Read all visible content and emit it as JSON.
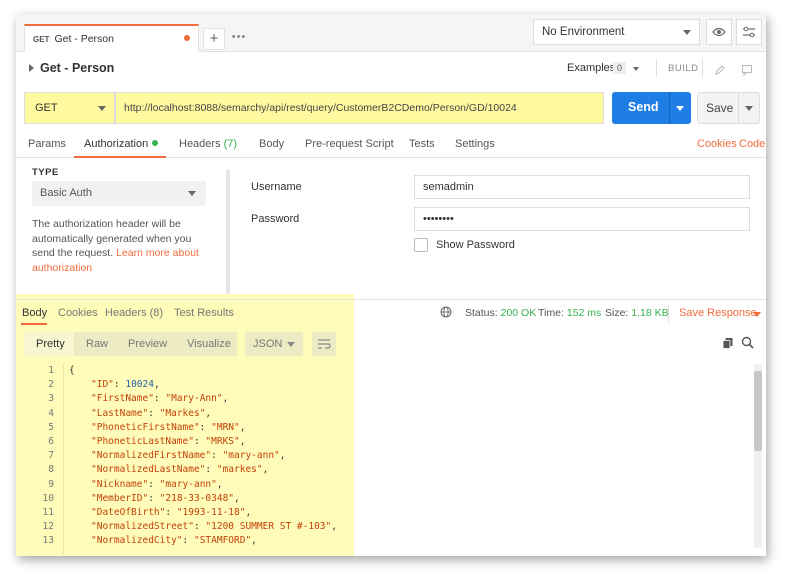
{
  "tabbar": {
    "tab_method": "GET",
    "tab_title": "Get - Person",
    "add_tab": "+",
    "more_tabs": "•••"
  },
  "environment": {
    "selected": "No Environment"
  },
  "request": {
    "name": "Get - Person",
    "examples_label": "Examples",
    "examples_count": "0",
    "build_label": "BUILD",
    "method": "GET",
    "url": "http://localhost:8088/semarchy/api/rest/query/CustomerB2CDemo/Person/GD/10024",
    "send_label": "Send",
    "save_label": "Save"
  },
  "request_tabs": [
    {
      "label": "Params"
    },
    {
      "label": "Authorization"
    },
    {
      "label": "Headers",
      "count": "(7)"
    },
    {
      "label": "Body"
    },
    {
      "label": "Pre-request Script"
    },
    {
      "label": "Tests"
    },
    {
      "label": "Settings"
    }
  ],
  "request_links": {
    "cookies": "Cookies",
    "code": "Code"
  },
  "auth": {
    "type_label": "TYPE",
    "type_value": "Basic Auth",
    "help_text": "The authorization header will be automatically generated when you send the request.",
    "help_link": "Learn more about authorization",
    "username_label": "Username",
    "username_value": "semadmin",
    "password_label": "Password",
    "password_value": "••••••••",
    "show_password_label": "Show Password"
  },
  "response": {
    "tabs": [
      {
        "label": "Body"
      },
      {
        "label": "Cookies"
      },
      {
        "label": "Headers",
        "count": "(8)"
      },
      {
        "label": "Test Results"
      }
    ],
    "status_label": "Status:",
    "status_value": "200 OK",
    "time_label": "Time:",
    "time_value": "152 ms",
    "size_label": "Size:",
    "size_value": "1.18 KB",
    "save_response": "Save Response",
    "view_modes": [
      "Pretty",
      "Raw",
      "Preview",
      "Visualize"
    ],
    "format": "JSON",
    "code_lines": [
      {
        "n": "1",
        "text": "{"
      },
      {
        "n": "2",
        "key": "\"ID\"",
        "val": "10024",
        "type": "num"
      },
      {
        "n": "3",
        "key": "\"FirstName\"",
        "val": "\"Mary-Ann\"",
        "type": "str"
      },
      {
        "n": "4",
        "key": "\"LastName\"",
        "val": "\"Markes\"",
        "type": "str"
      },
      {
        "n": "5",
        "key": "\"PhoneticFirstName\"",
        "val": "\"MRN\"",
        "type": "str"
      },
      {
        "n": "6",
        "key": "\"PhoneticLastName\"",
        "val": "\"MRKS\"",
        "type": "str"
      },
      {
        "n": "7",
        "key": "\"NormalizedFirstName\"",
        "val": "\"mary-ann\"",
        "type": "str"
      },
      {
        "n": "8",
        "key": "\"NormalizedLastName\"",
        "val": "\"markes\"",
        "type": "str"
      },
      {
        "n": "9",
        "key": "\"Nickname\"",
        "val": "\"mary-ann\"",
        "type": "str"
      },
      {
        "n": "10",
        "key": "\"MemberID\"",
        "val": "\"218-33-0348\"",
        "type": "str"
      },
      {
        "n": "11",
        "key": "\"DateOfBirth\"",
        "val": "\"1993-11-18\"",
        "type": "str"
      },
      {
        "n": "12",
        "key": "\"NormalizedStreet\"",
        "val": "\"1200 SUMMER ST #-103\"",
        "type": "str"
      },
      {
        "n": "13",
        "key": "\"NormalizedCity\"",
        "val": "\"STAMFORD\"",
        "type": "str"
      }
    ]
  },
  "colors": {
    "accent": "#f26b3a",
    "send": "#1e7ee6",
    "success": "#37b24d",
    "highlight": "#fffaa0"
  }
}
